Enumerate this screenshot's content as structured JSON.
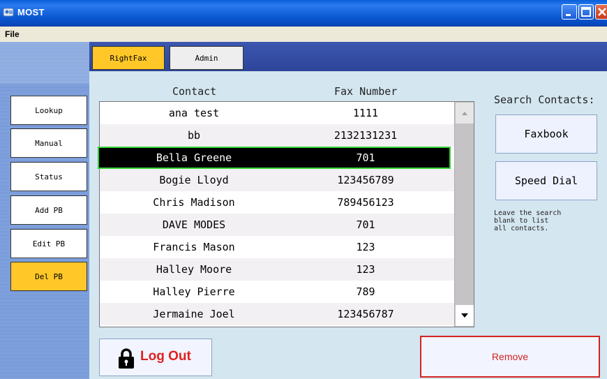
{
  "window": {
    "title": "MOST"
  },
  "menu": {
    "file": "File"
  },
  "tabs": [
    {
      "label": "RightFax",
      "active": true
    },
    {
      "label": "Admin",
      "active": false
    }
  ],
  "nav": [
    {
      "label": "Lookup",
      "active": false
    },
    {
      "label": "Manual",
      "active": false
    },
    {
      "label": "Status",
      "active": false
    },
    {
      "label": "Add PB",
      "active": false
    },
    {
      "label": "Edit PB",
      "active": false
    },
    {
      "label": "Del PB",
      "active": true
    }
  ],
  "table": {
    "headers": {
      "contact": "Contact",
      "fax": "Fax Number"
    },
    "rows": [
      {
        "contact": "ana test",
        "fax": "1111"
      },
      {
        "contact": "bb",
        "fax": "2132131231"
      },
      {
        "contact": "Bella Greene",
        "fax": "701",
        "selected": true
      },
      {
        "contact": "Bogie Lloyd",
        "fax": "123456789"
      },
      {
        "contact": "Chris Madison",
        "fax": "789456123"
      },
      {
        "contact": "DAVE MODES",
        "fax": "701"
      },
      {
        "contact": "Francis Mason",
        "fax": "123"
      },
      {
        "contact": "Halley Moore",
        "fax": "123"
      },
      {
        "contact": "Halley Pierre",
        "fax": "789"
      },
      {
        "contact": "Jermaine Joel",
        "fax": "123456787"
      }
    ]
  },
  "search": {
    "label": "Search Contacts:",
    "faxbook": "Faxbook",
    "speed_dial": "Speed Dial",
    "hint": "Leave the search\nblank to list\nall contacts."
  },
  "actions": {
    "logout": "Log Out",
    "remove": "Remove"
  },
  "colors": {
    "accent": "#ffc727",
    "danger": "#d32222",
    "selection_outline": "#35d435"
  },
  "icons": {
    "lock": "lock-icon",
    "app": "app-icon"
  }
}
